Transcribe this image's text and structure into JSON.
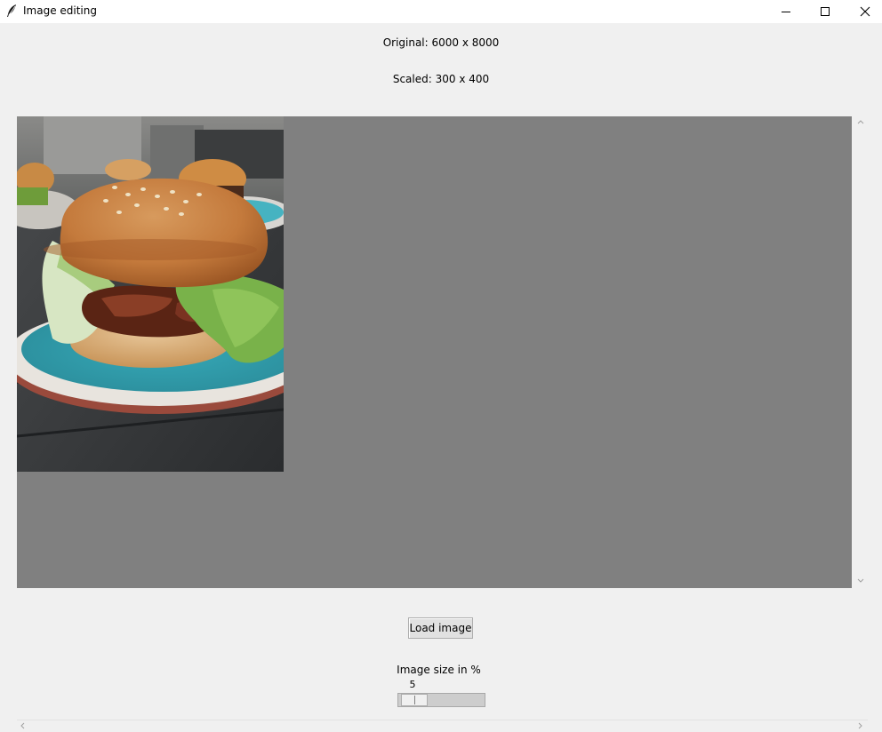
{
  "window": {
    "title": "Image editing",
    "controls": {
      "minimize_icon": "minimize-icon",
      "maximize_icon": "maximize-icon",
      "close_icon": "close-icon"
    },
    "app_icon": "feather-icon"
  },
  "info": {
    "original": "Original: 6000 x 8000",
    "scaled": "Scaled: 300 x 400"
  },
  "canvas": {
    "background": "#808080",
    "image_subject": "burger on blue plate"
  },
  "controls": {
    "load_button": "Load image",
    "scale_label": "Image size in %",
    "scale_value": "5",
    "scale_min": 1,
    "scale_max": 100,
    "scale_current": 5
  },
  "colors": {
    "window_bg": "#f0f0f0",
    "canvas_bg": "#808080",
    "plate": "#3fb8c6"
  }
}
